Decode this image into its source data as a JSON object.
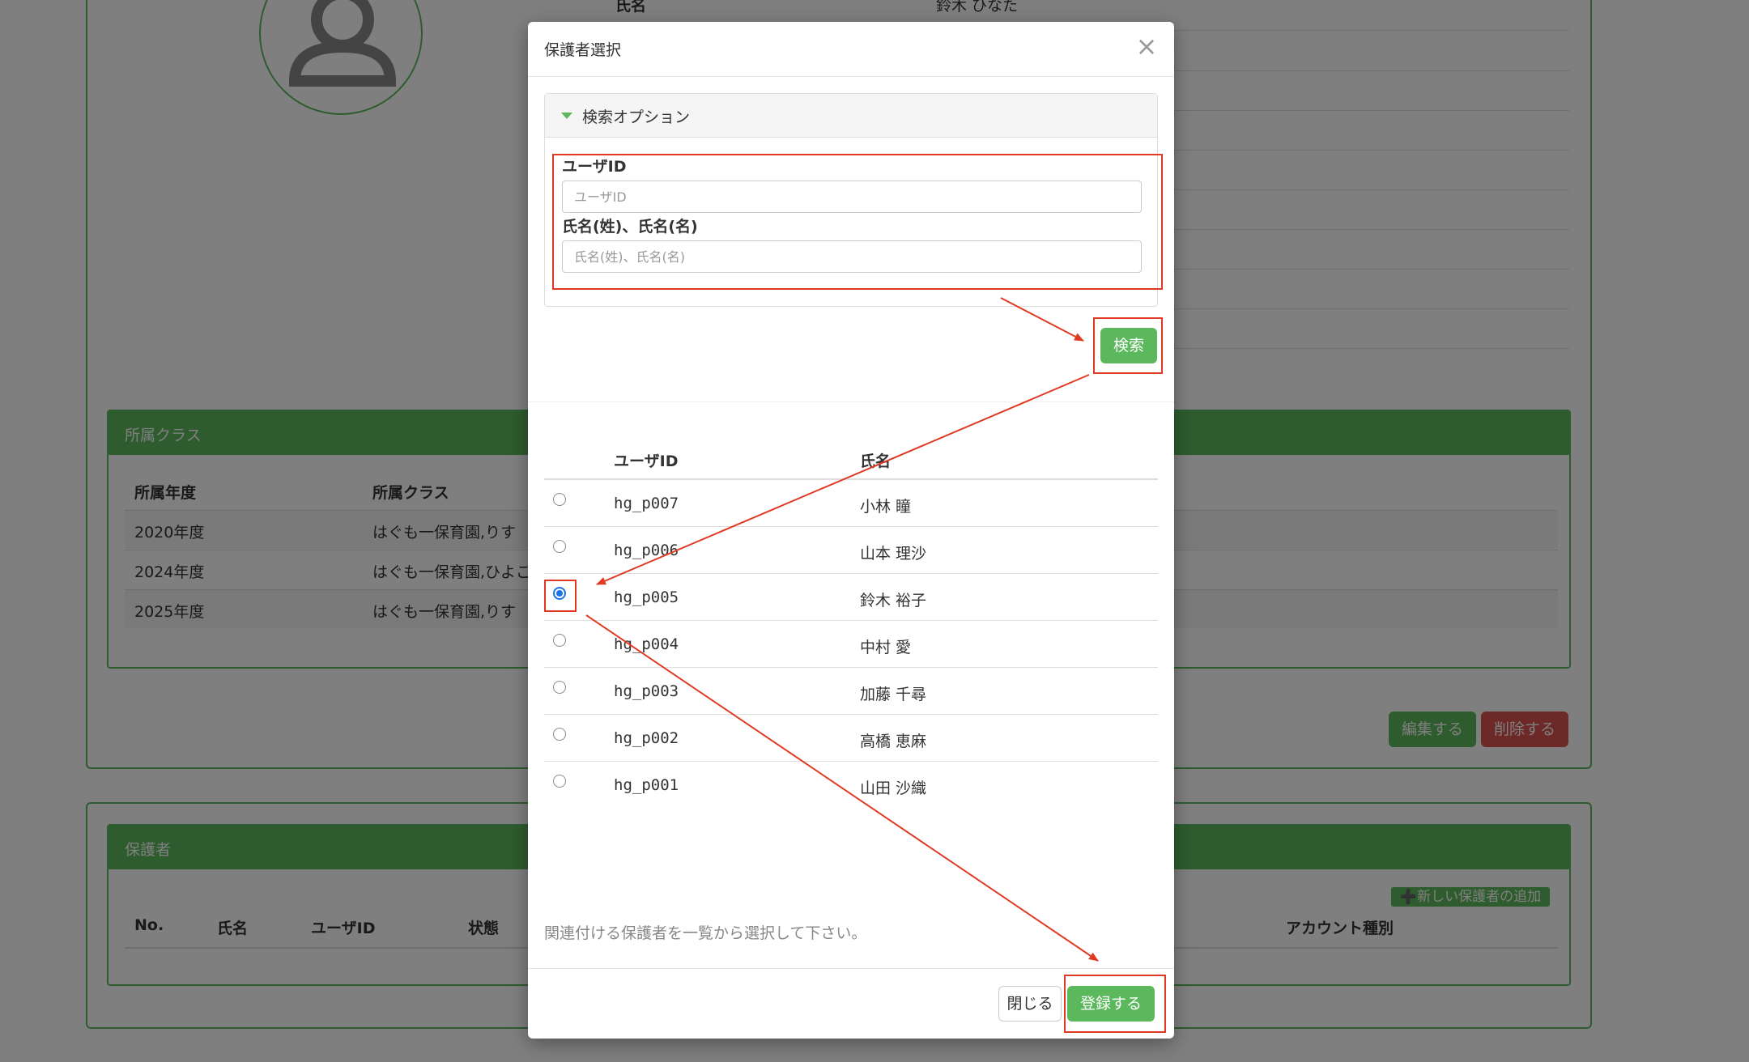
{
  "student": {
    "name_label": "氏名",
    "name_value": "鈴木 ひなた"
  },
  "class_section": {
    "title": "所属クラス",
    "columns": [
      "所属年度",
      "所属クラス"
    ],
    "rows": [
      {
        "year": "2020年度",
        "class": "はぐも一保育園,りす"
      },
      {
        "year": "2024年度",
        "class": "はぐも一保育園,ひよこ"
      },
      {
        "year": "2025年度",
        "class": "はぐも一保育園,りす"
      }
    ],
    "edit_label": "編集する",
    "delete_label": "削除する"
  },
  "guardian_section": {
    "title": "保護者",
    "add_label": "➕新しい保護者の追加",
    "columns": [
      "No.",
      "氏名",
      "ユーザID",
      "状態",
      "アカウント種別"
    ]
  },
  "modal": {
    "title": "保護者選択",
    "close_glyph": "×",
    "search_options_title": "検索オプション",
    "user_id_label": "ユーザID",
    "user_id_placeholder": "ユーザID",
    "name_label": "氏名(姓)、氏名(名)",
    "name_placeholder": "氏名(姓)、氏名(名)",
    "search_button": "検索",
    "list_columns": {
      "user_id": "ユーザID",
      "name": "氏名"
    },
    "rows": [
      {
        "user_id": "hg_p007",
        "name": "小林 瞳",
        "selected": false
      },
      {
        "user_id": "hg_p006",
        "name": "山本 理沙",
        "selected": false
      },
      {
        "user_id": "hg_p005",
        "name": "鈴木 裕子",
        "selected": true
      },
      {
        "user_id": "hg_p004",
        "name": "中村 愛",
        "selected": false
      },
      {
        "user_id": "hg_p003",
        "name": "加藤 千尋",
        "selected": false
      },
      {
        "user_id": "hg_p002",
        "name": "高橋 恵麻",
        "selected": false
      },
      {
        "user_id": "hg_p001",
        "name": "山田 沙織",
        "selected": false
      }
    ],
    "help_text": "関連付ける保護者を一覧から選択して下さい。",
    "close_button": "閉じる",
    "register_button": "登録する"
  },
  "colors": {
    "accent_green": "#5cb85c",
    "danger_red": "#d9534f",
    "annotation_red": "#e03a24",
    "radio_blue": "#1a73e8"
  }
}
